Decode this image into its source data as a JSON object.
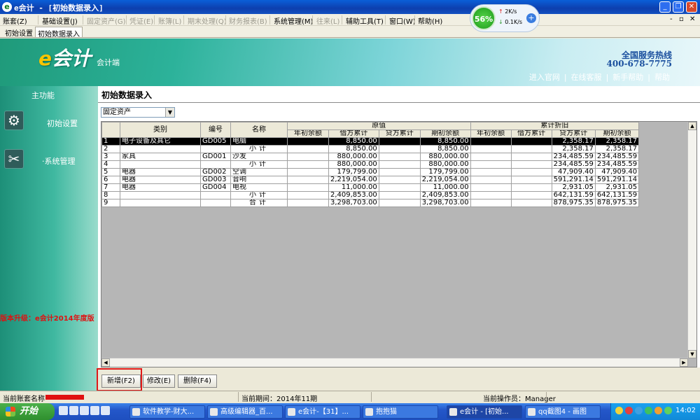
{
  "window": {
    "logo": "e",
    "title": "e会计 - [初始数据录入]",
    "min": "_",
    "restore": "❐",
    "close": "✕"
  },
  "menu": [
    {
      "label": "账套(Z)",
      "disabled": false
    },
    {
      "label": "基础设置(J)",
      "disabled": false
    },
    {
      "label": "固定资产(G)",
      "disabled": true
    },
    {
      "label": "凭证(E)",
      "disabled": true
    },
    {
      "label": "账簿(L)",
      "disabled": true
    },
    {
      "label": "期末处理(Q)",
      "disabled": true
    },
    {
      "label": "财务报表(B)",
      "disabled": true
    },
    {
      "label": "系统管理(M)",
      "disabled": false
    },
    {
      "label": "往来(L)",
      "disabled": true
    },
    {
      "label": "辅助工具(T)",
      "disabled": false
    },
    {
      "label": "窗口(W)",
      "disabled": false
    },
    {
      "label": "帮助(H)",
      "disabled": false
    }
  ],
  "mdi_controls": {
    "min": "-",
    "restore": "▫",
    "close": "✕"
  },
  "tabs": [
    {
      "label": "初始设置"
    },
    {
      "label": "初始数据录入"
    }
  ],
  "netmon": {
    "percent": "56%",
    "up": "2K/s",
    "down": "0.1K/s",
    "plus": "+"
  },
  "banner": {
    "logo_e": "e",
    "logo_rest": "会计",
    "subtitle": "会计端",
    "hotline": "全国服务热线",
    "phone": "400-678-7775",
    "links": [
      "进入官网",
      "|",
      "在线客服",
      "|",
      "新手帮助",
      "|",
      "帮助"
    ]
  },
  "sidebar": {
    "title": "主功能",
    "items": [
      {
        "label": "初始设置",
        "icon": "gear-icon"
      },
      {
        "label": "·系统管理",
        "icon": "tools-icon"
      }
    ],
    "upgrade": "版本升级：e会计2014年度版"
  },
  "page": {
    "title": "初始数据录入",
    "combo_value": "固定资产",
    "combo_arrow": "▼"
  },
  "table": {
    "group_headers": {
      "yuanzhi": "原值",
      "zhejiu": "累计折旧"
    },
    "headers": {
      "row": "",
      "leibie": "类别",
      "bianhao": "编号",
      "mingcheng": "名称"
    },
    "sub_headers": [
      "年初余额",
      "借方累计",
      "贷方累计",
      "期初余额",
      "年初余额",
      "借方累计",
      "贷方累计",
      "期初余额"
    ],
    "rows": [
      {
        "n": "1",
        "cat": "电子设备及其它",
        "code": "GD005",
        "name": "电脑",
        "v": [
          "",
          "8,850.00",
          "",
          "8,850.00",
          "",
          "",
          "2,358.17",
          "2,358.17"
        ],
        "sel": true,
        "sub": false
      },
      {
        "n": "2",
        "cat": "",
        "code": "",
        "name": "小计",
        "v": [
          "",
          "8,850.00",
          "",
          "8,850.00",
          "",
          "",
          "2,358.17",
          "2,358.17"
        ],
        "sel": false,
        "sub": true
      },
      {
        "n": "3",
        "cat": "家具",
        "code": "GD001",
        "name": "沙发",
        "v": [
          "",
          "880,000.00",
          "",
          "880,000.00",
          "",
          "",
          "234,485.59",
          "234,485.59"
        ],
        "sel": false,
        "sub": false
      },
      {
        "n": "4",
        "cat": "",
        "code": "",
        "name": "小计",
        "v": [
          "",
          "880,000.00",
          "",
          "880,000.00",
          "",
          "",
          "234,485.59",
          "234,485.59"
        ],
        "sel": false,
        "sub": true
      },
      {
        "n": "5",
        "cat": "电器",
        "code": "GD002",
        "name": "空调",
        "v": [
          "",
          "179,799.00",
          "",
          "179,799.00",
          "",
          "",
          "47,909.40",
          "47,909.40"
        ],
        "sel": false,
        "sub": false
      },
      {
        "n": "6",
        "cat": "电器",
        "code": "GD003",
        "name": "音响",
        "v": [
          "",
          "2,219,054.00",
          "",
          "2,219,054.00",
          "",
          "",
          "591,291.14",
          "591,291.14"
        ],
        "sel": false,
        "sub": false
      },
      {
        "n": "7",
        "cat": "电器",
        "code": "GD004",
        "name": "电视",
        "v": [
          "",
          "11,000.00",
          "",
          "11,000.00",
          "",
          "",
          "2,931.05",
          "2,931.05"
        ],
        "sel": false,
        "sub": false
      },
      {
        "n": "8",
        "cat": "",
        "code": "",
        "name": "小计",
        "v": [
          "",
          "2,409,853.00",
          "",
          "2,409,853.00",
          "",
          "",
          "642,131.59",
          "642,131.59"
        ],
        "sel": false,
        "sub": true
      },
      {
        "n": "9",
        "cat": "",
        "code": "",
        "name": "合计",
        "v": [
          "",
          "3,298,703.00",
          "",
          "3,298,703.00",
          "",
          "",
          "878,975.35",
          "878,975.35"
        ],
        "sel": false,
        "sub": true
      }
    ]
  },
  "scroll": {
    "up": "▲",
    "down": "▼",
    "left": "◀",
    "right": "▶"
  },
  "actions": {
    "add": "新增(F2)",
    "edit": "修改(E)",
    "del": "删除(F4)"
  },
  "status": {
    "account_label": "当前账套名称",
    "period": "当前期间：2014年11期",
    "operator": "当前操作员：Manager"
  },
  "taskbar": {
    "start": "开始",
    "buttons": [
      "软件教学-财大...",
      "高级编辑器_百...",
      "e会计-【31】...",
      "抱抱猫",
      "e会计 - [初始...",
      "qq截图4 - 画图"
    ],
    "clock": "14:02"
  },
  "colors": {
    "accent": "#0a5fd8",
    "selected_row": "#000000",
    "highlight": "#e01818"
  }
}
